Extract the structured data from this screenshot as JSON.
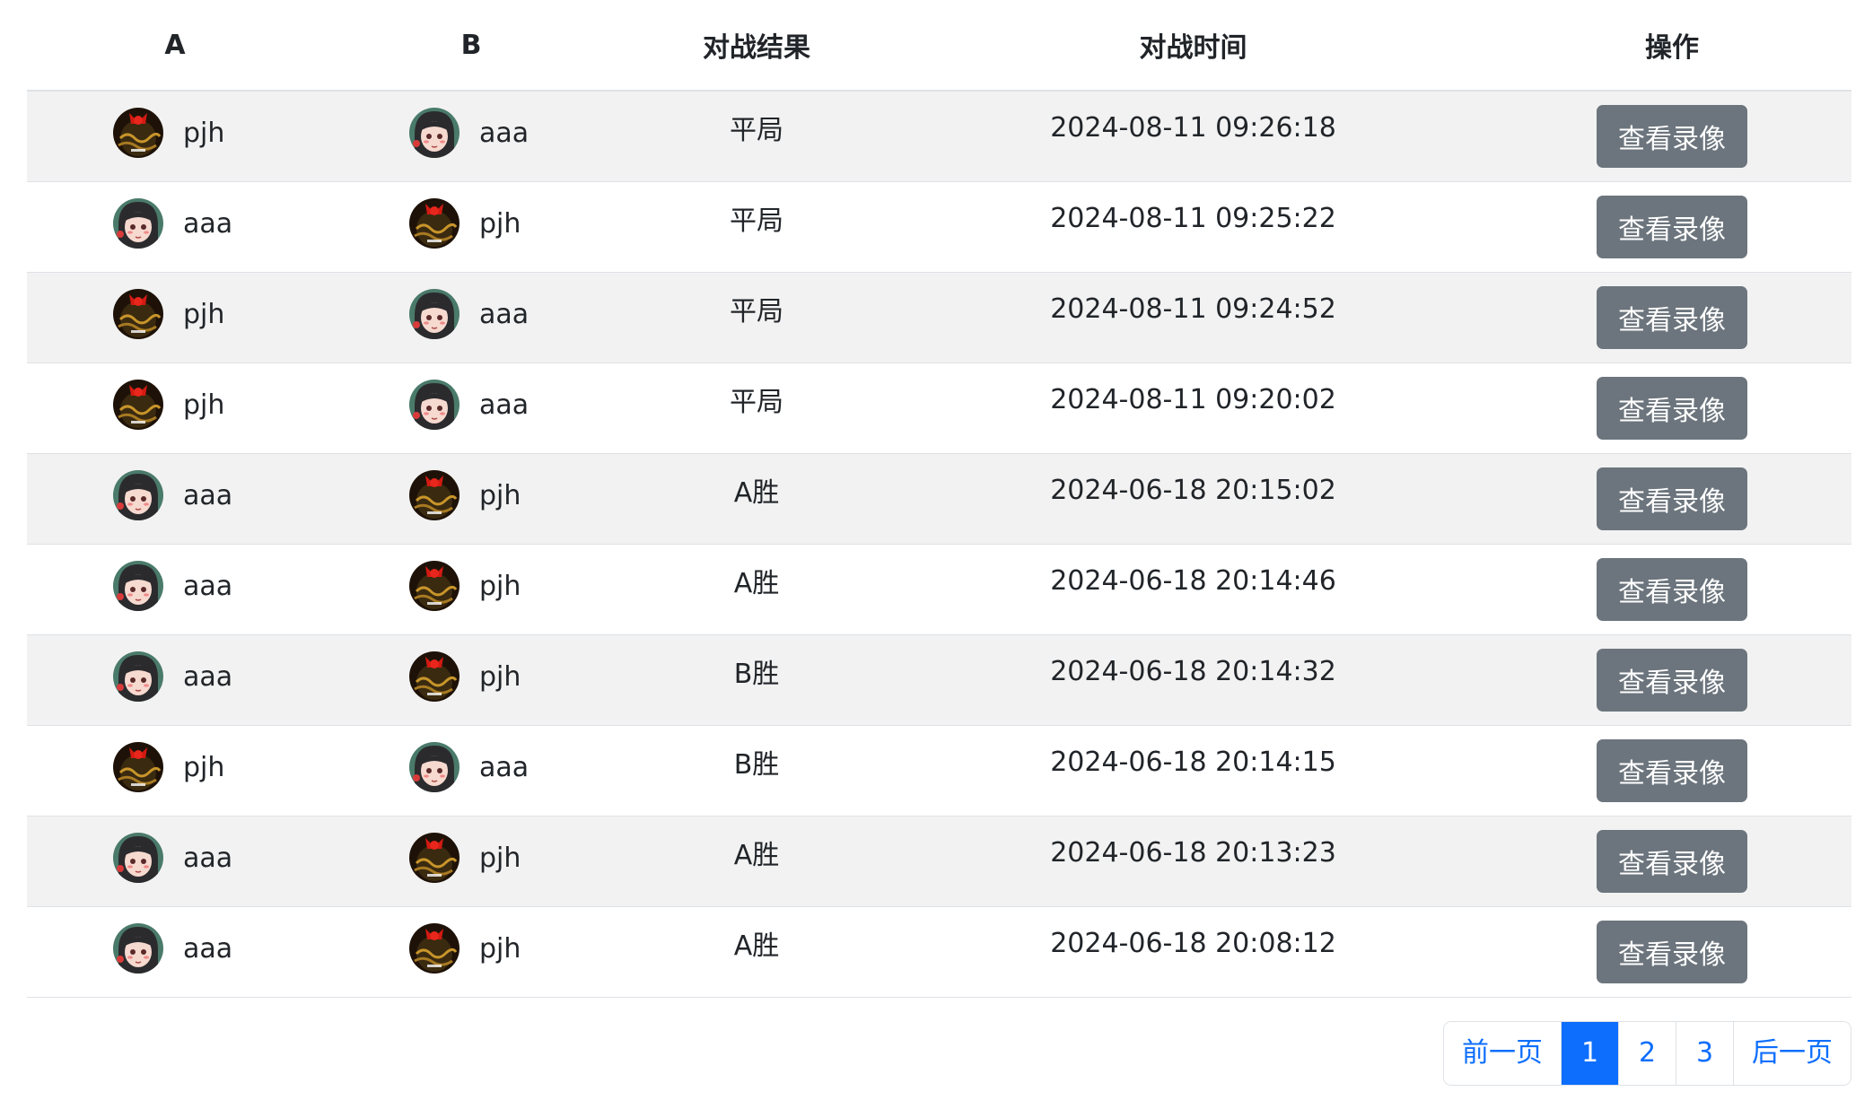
{
  "table": {
    "headers": {
      "a": "A",
      "b": "B",
      "result": "对战结果",
      "time": "对战时间",
      "action": "操作"
    },
    "button_label": "查看录像",
    "rows": [
      {
        "a": "pjh",
        "b": "aaa",
        "result": "平局",
        "time": "2024-08-11 09:26:18"
      },
      {
        "a": "aaa",
        "b": "pjh",
        "result": "平局",
        "time": "2024-08-11 09:25:22"
      },
      {
        "a": "pjh",
        "b": "aaa",
        "result": "平局",
        "time": "2024-08-11 09:24:52"
      },
      {
        "a": "pjh",
        "b": "aaa",
        "result": "平局",
        "time": "2024-08-11 09:20:02"
      },
      {
        "a": "aaa",
        "b": "pjh",
        "result": "A胜",
        "time": "2024-06-18 20:15:02"
      },
      {
        "a": "aaa",
        "b": "pjh",
        "result": "A胜",
        "time": "2024-06-18 20:14:46"
      },
      {
        "a": "aaa",
        "b": "pjh",
        "result": "B胜",
        "time": "2024-06-18 20:14:32"
      },
      {
        "a": "pjh",
        "b": "aaa",
        "result": "B胜",
        "time": "2024-06-18 20:14:15"
      },
      {
        "a": "aaa",
        "b": "pjh",
        "result": "A胜",
        "time": "2024-06-18 20:13:23"
      },
      {
        "a": "aaa",
        "b": "pjh",
        "result": "A胜",
        "time": "2024-06-18 20:08:12"
      }
    ]
  },
  "avatars": {
    "pjh": "dark-red-avatar-icon",
    "aaa": "anime-girl-avatar-icon"
  },
  "pagination": {
    "prev": "前一页",
    "pages": [
      "1",
      "2",
      "3"
    ],
    "active_page": "1",
    "next": "后一页"
  },
  "colors": {
    "button_bg": "#6c757d",
    "link": "#0d6efd",
    "active_page_bg": "#0d6efd",
    "striped_row": "#f2f2f2"
  }
}
